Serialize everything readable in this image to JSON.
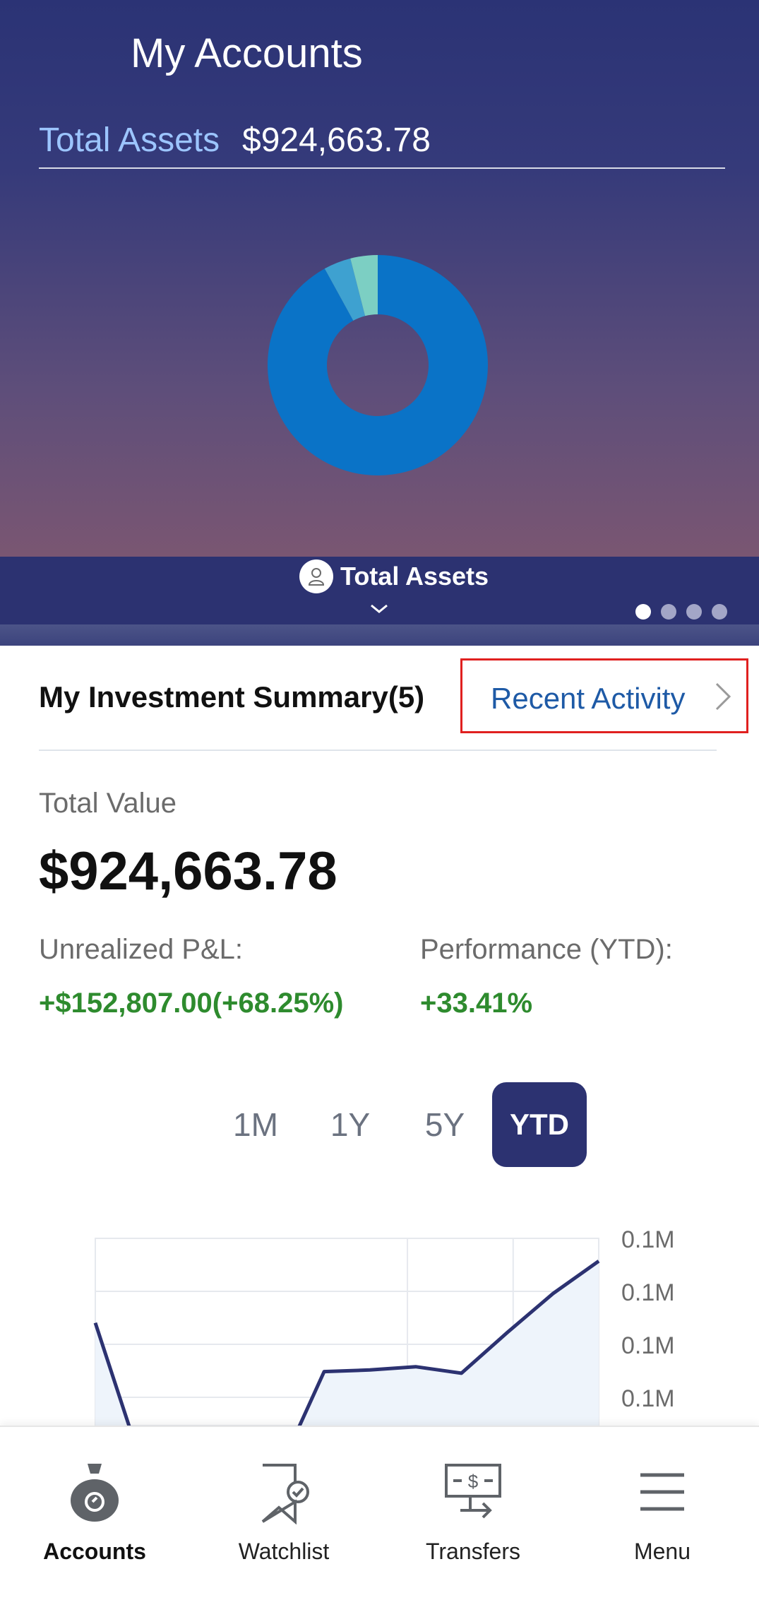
{
  "header": {
    "title": "My Accounts",
    "total_assets_label": "Total Assets",
    "total_assets_value": "$924,663.78",
    "tab_label": "Total Assets",
    "carousel_pages": 4,
    "carousel_active_index": 0
  },
  "donut": {
    "segments": [
      {
        "color": "#0a73c7",
        "fraction": 0.92
      },
      {
        "color": "#3ea1d0",
        "fraction": 0.04
      },
      {
        "color": "#7ccfc3",
        "fraction": 0.04
      }
    ]
  },
  "summary": {
    "title": "My Investment Summary(5)",
    "recent_activity_label": "Recent Activity",
    "total_value_label": "Total Value",
    "total_value": "$924,663.78",
    "unrealized_label": "Unrealized P&L:",
    "unrealized_value": "+$152,807.00(+68.25%)",
    "performance_label": "Performance (YTD):",
    "performance_value": "+33.41%"
  },
  "periods": [
    {
      "label": "1M",
      "active": false
    },
    {
      "label": "1Y",
      "active": false
    },
    {
      "label": "5Y",
      "active": false
    },
    {
      "label": "YTD",
      "active": true
    }
  ],
  "chart_data": {
    "type": "area",
    "y_tick_labels": [
      "0.1M",
      "0.1M",
      "0.1M",
      "0.1M"
    ],
    "series": [
      {
        "color": "#2c3271",
        "values": [
          0.73,
          0.3,
          0.28,
          0.28,
          0.27,
          0.58,
          0.585,
          0.595,
          0.575,
          0.7,
          0.82,
          0.92
        ]
      }
    ]
  },
  "colors": {
    "brand_navy": "#2c3271",
    "gain_green": "#2e8b2e",
    "link_blue": "#1e5aa6",
    "highlight_red": "#e0201f"
  },
  "nav": [
    {
      "label": "Accounts",
      "icon": "money-bag-icon",
      "active": true
    },
    {
      "label": "Watchlist",
      "icon": "bookmark-check-icon",
      "active": false
    },
    {
      "label": "Transfers",
      "icon": "transfer-icon",
      "active": false
    },
    {
      "label": "Menu",
      "icon": "hamburger-icon",
      "active": false
    }
  ]
}
